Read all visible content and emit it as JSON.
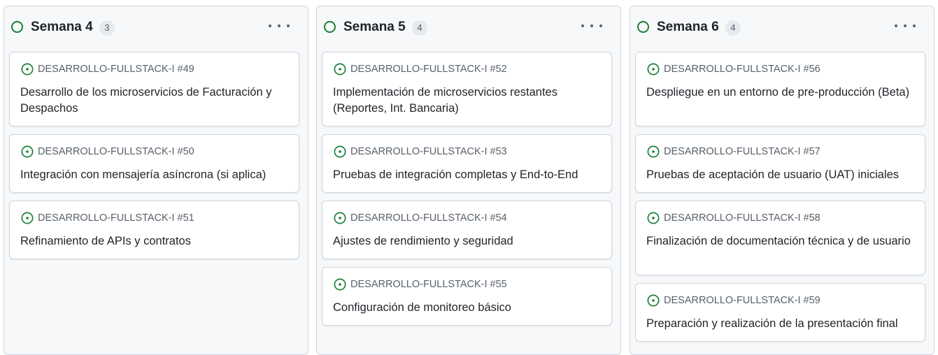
{
  "theme": {
    "accent": "#1a7f37",
    "card_bg": "#ffffff",
    "column_bg": "#f6f8fa",
    "border": "#d0d7de"
  },
  "columns": [
    {
      "title": "Semana 4",
      "count": "3",
      "status_icon": "circle-open-icon",
      "menu_icon": "ellipsis-icon",
      "cards": [
        {
          "ref": "DESARROLLO-FULLSTACK-I #49",
          "title": "Desarrollo de los microservicios de Facturación y Despachos"
        },
        {
          "ref": "DESARROLLO-FULLSTACK-I #50",
          "title": "Integración con mensajería asíncrona (si aplica)"
        },
        {
          "ref": "DESARROLLO-FULLSTACK-I #51",
          "title": "Refinamiento de APIs y contratos"
        }
      ]
    },
    {
      "title": "Semana 5",
      "count": "4",
      "status_icon": "circle-open-icon",
      "menu_icon": "ellipsis-icon",
      "cards": [
        {
          "ref": "DESARROLLO-FULLSTACK-I #52",
          "title": "Implementación de microservicios restantes (Reportes, Int. Bancaria)"
        },
        {
          "ref": "DESARROLLO-FULLSTACK-I #53",
          "title": "Pruebas de integración completas y End-to-End"
        },
        {
          "ref": "DESARROLLO-FULLSTACK-I #54",
          "title": "Ajustes de rendimiento y seguridad"
        },
        {
          "ref": "DESARROLLO-FULLSTACK-I #55",
          "title": "Configuración de monitoreo básico"
        }
      ]
    },
    {
      "title": "Semana 6",
      "count": "4",
      "status_icon": "circle-open-icon",
      "menu_icon": "ellipsis-icon",
      "cards": [
        {
          "ref": "DESARROLLO-FULLSTACK-I #56",
          "title": "Despliegue en un entorno de pre-producción (Beta)"
        },
        {
          "ref": "DESARROLLO-FULLSTACK-I #57",
          "title": "Pruebas de aceptación de usuario (UAT) iniciales"
        },
        {
          "ref": "DESARROLLO-FULLSTACK-I #58",
          "title": "Finalización de documentación técnica y de usuario"
        },
        {
          "ref": "DESARROLLO-FULLSTACK-I #59",
          "title": "Preparación y realización de la presentación final"
        }
      ]
    }
  ]
}
